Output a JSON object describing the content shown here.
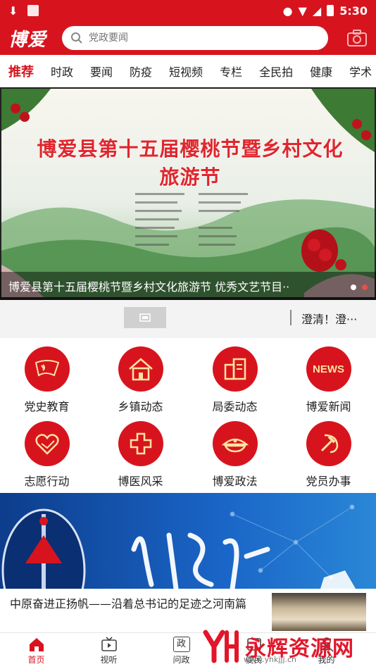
{
  "status_bar": {
    "time": "5:30"
  },
  "header": {
    "logo": "博爱",
    "search_placeholder": "党政要闻"
  },
  "tabs": [
    "推荐",
    "时政",
    "要闻",
    "防疫",
    "短视频",
    "专栏",
    "全民拍",
    "健康",
    "学术"
  ],
  "banner": {
    "headline": "博爱县第十五届樱桃节暨乡村文化旅游节",
    "caption": "博爱县第十五届樱桃节暨乡村文化旅游节 优秀文艺节目··"
  },
  "ticker": {
    "text": "澄清！澄···"
  },
  "grid": [
    {
      "label": "党史教育",
      "icon": "party-flag-icon"
    },
    {
      "label": "乡镇动态",
      "icon": "house-icon"
    },
    {
      "label": "局委动态",
      "icon": "building-doc-icon"
    },
    {
      "label": "博爱新闻",
      "icon": "news-icon",
      "icon_text": "NEWS"
    },
    {
      "label": "志愿行动",
      "icon": "heart-hand-icon"
    },
    {
      "label": "博医风采",
      "icon": "red-cross-icon"
    },
    {
      "label": "博爱政法",
      "icon": "police-cap-icon"
    },
    {
      "label": "党员办事",
      "icon": "hammer-sickle-icon"
    }
  ],
  "news": {
    "title": "中原奋进正扬帆——沿着总书记的足迹之河南篇"
  },
  "bottom_nav": [
    {
      "label": "首页",
      "active": true,
      "icon": "home-icon"
    },
    {
      "label": "视听",
      "active": false,
      "icon": "tv-icon"
    },
    {
      "label": "问政",
      "active": false,
      "icon": "politics-icon",
      "icon_text": "政"
    },
    {
      "label": "便民",
      "active": false,
      "icon": "service-icon"
    },
    {
      "label": "我的",
      "active": false,
      "icon": "user-icon"
    }
  ],
  "watermark": {
    "brand": "永辉资源网",
    "url": "www.yhkjjj.cn"
  },
  "colors": {
    "brand_red": "#d7141e"
  }
}
